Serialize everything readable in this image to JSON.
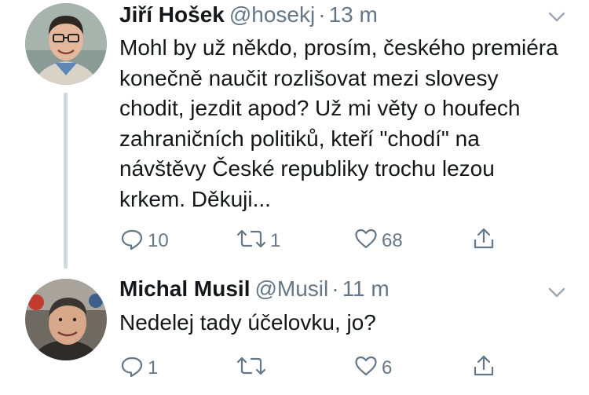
{
  "tweets": [
    {
      "display_name": "Jiří Hošek",
      "handle": "@hosekj",
      "separator": "·",
      "time": "13 m",
      "text": "Mohl by už někdo, prosím, českého premiéra konečně naučit rozlišovat mezi slovesy chodit, jezdit apod? Už mi věty o houfech zahraničních politiků, kteří \"chodí\" na návštěvy České republiky trochu lezou krkem. Děkuji...",
      "replies": "10",
      "retweets": "1",
      "likes": "68"
    },
    {
      "display_name": "Michal Musil",
      "handle": "@Musil",
      "separator": "·",
      "time": "11 m",
      "text": "Nedelej tady účelovku, jo?",
      "replies": "1",
      "retweets": "",
      "likes": "6"
    }
  ],
  "icons": {
    "reply": "speech-bubble-icon",
    "retweet": "retweet-arrows-icon",
    "like": "heart-icon",
    "share": "share-upload-icon",
    "menu": "chevron-down-icon"
  },
  "colors": {
    "text_primary": "#14171a",
    "text_secondary": "#657786",
    "thread_line": "#cfd9de"
  }
}
